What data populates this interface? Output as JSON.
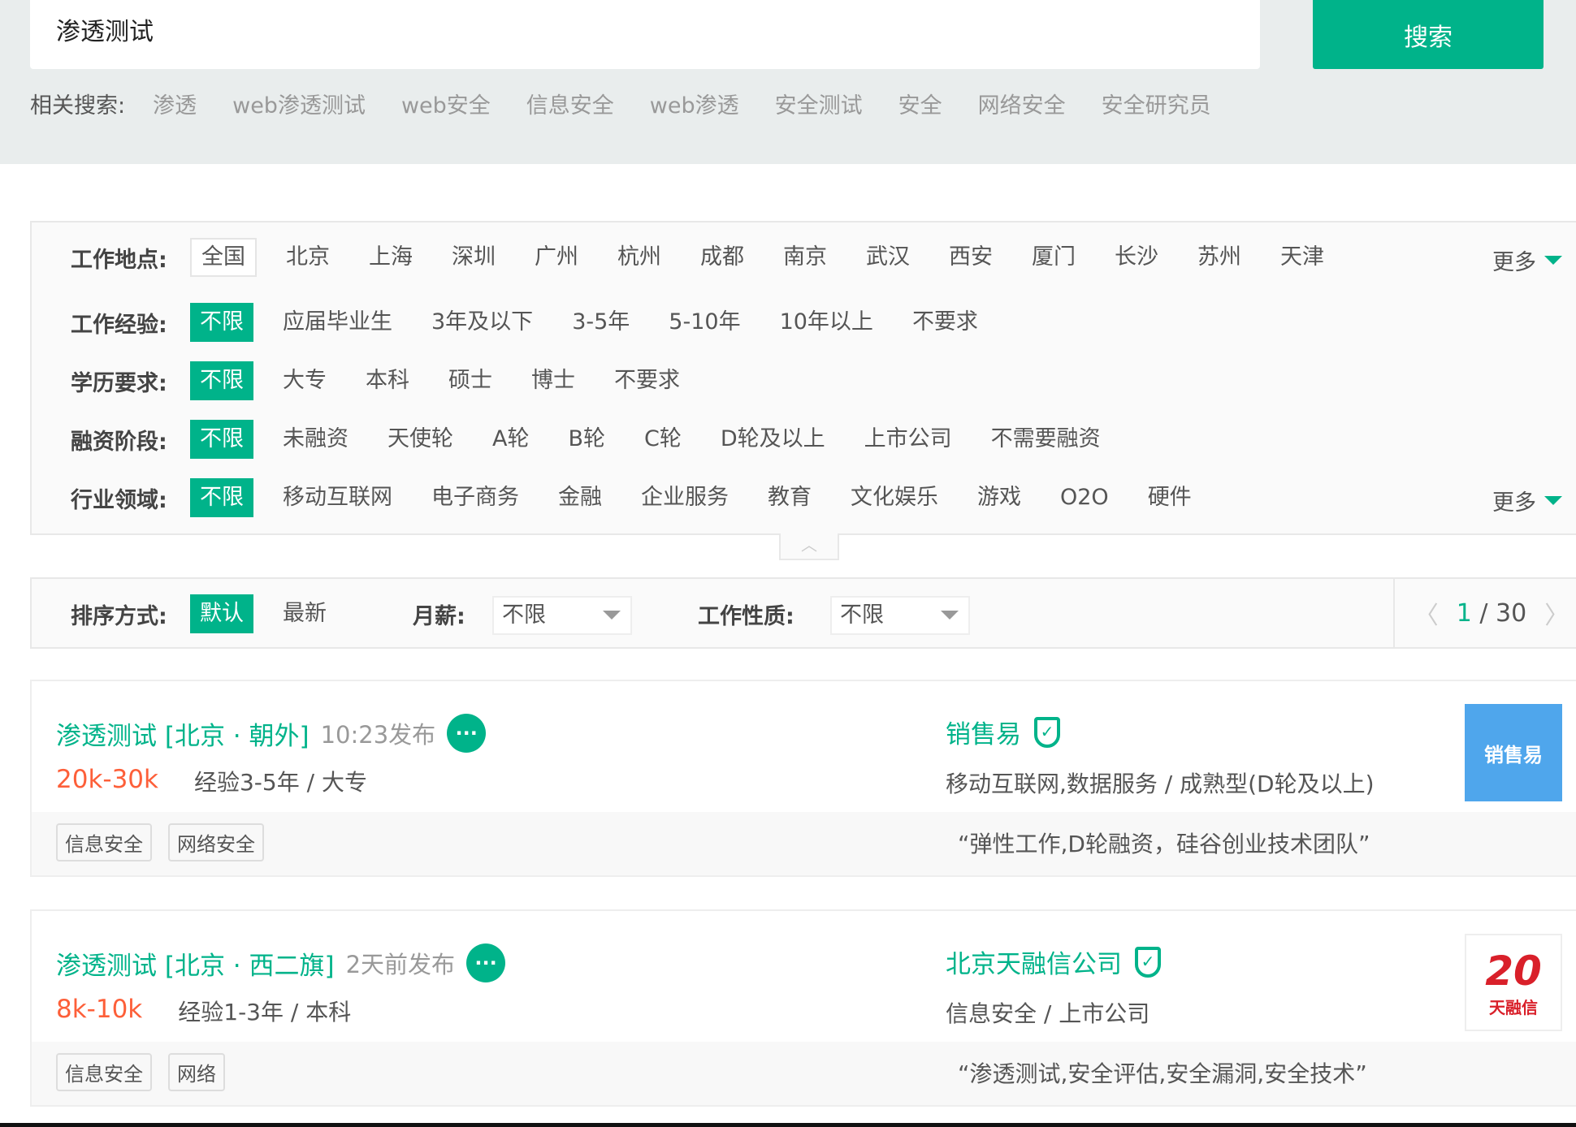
{
  "search": {
    "value": "渗透测试",
    "button": "搜索"
  },
  "related": {
    "label": "相关搜索:",
    "items": [
      "渗透",
      "web渗透测试",
      "web安全",
      "信息安全",
      "web渗透",
      "安全测试",
      "安全",
      "网络安全",
      "安全研究员"
    ]
  },
  "filters": [
    {
      "label": "工作地点:",
      "options": [
        "全国",
        "北京",
        "上海",
        "深圳",
        "广州",
        "杭州",
        "成都",
        "南京",
        "武汉",
        "西安",
        "厦门",
        "长沙",
        "苏州",
        "天津"
      ],
      "more": "更多"
    },
    {
      "label": "工作经验:",
      "options": [
        "不限",
        "应届毕业生",
        "3年及以下",
        "3-5年",
        "5-10年",
        "10年以上",
        "不要求"
      ]
    },
    {
      "label": "学历要求:",
      "options": [
        "不限",
        "大专",
        "本科",
        "硕士",
        "博士",
        "不要求"
      ]
    },
    {
      "label": "融资阶段:",
      "options": [
        "不限",
        "未融资",
        "天使轮",
        "A轮",
        "B轮",
        "C轮",
        "D轮及以上",
        "上市公司",
        "不需要融资"
      ]
    },
    {
      "label": "行业领域:",
      "options": [
        "不限",
        "移动互联网",
        "电子商务",
        "金融",
        "企业服务",
        "教育",
        "文化娱乐",
        "游戏",
        "O2O",
        "硬件"
      ],
      "more": "更多"
    }
  ],
  "sort": {
    "label": "排序方式:",
    "options": [
      "默认",
      "最新"
    ],
    "salary_label": "月薪:",
    "salary_value": "不限",
    "nature_label": "工作性质:",
    "nature_value": "不限",
    "page": "1",
    "sep": "/",
    "total": "30"
  },
  "jobs": [
    {
      "title": "渗透测试 [北京 · 朝外]",
      "time": "10:23发布",
      "salary": "20k-30k",
      "req": "经验3-5年 / 大专",
      "tags": [
        "信息安全",
        "网络安全"
      ],
      "company": "销售易",
      "industry": "移动互联网,数据服务 / 成熟型(D轮及以上)",
      "advantage": "“弹性工作,D轮融资，硅谷创业技术团队”",
      "logo_text": "销售易"
    },
    {
      "title": "渗透测试 [北京 · 西二旗]",
      "time": "2天前发布",
      "salary": "8k-10k",
      "req": "经验1-3年 / 本科",
      "tags": [
        "信息安全",
        "网络"
      ],
      "company": "北京天融信公司",
      "industry": "信息安全 / 上市公司",
      "advantage": "“渗透测试,安全评估,安全漏洞,安全技术”",
      "logo_text": "天融信"
    }
  ],
  "colors": {
    "accent": "#00b38a",
    "salary": "#fd5f39"
  }
}
